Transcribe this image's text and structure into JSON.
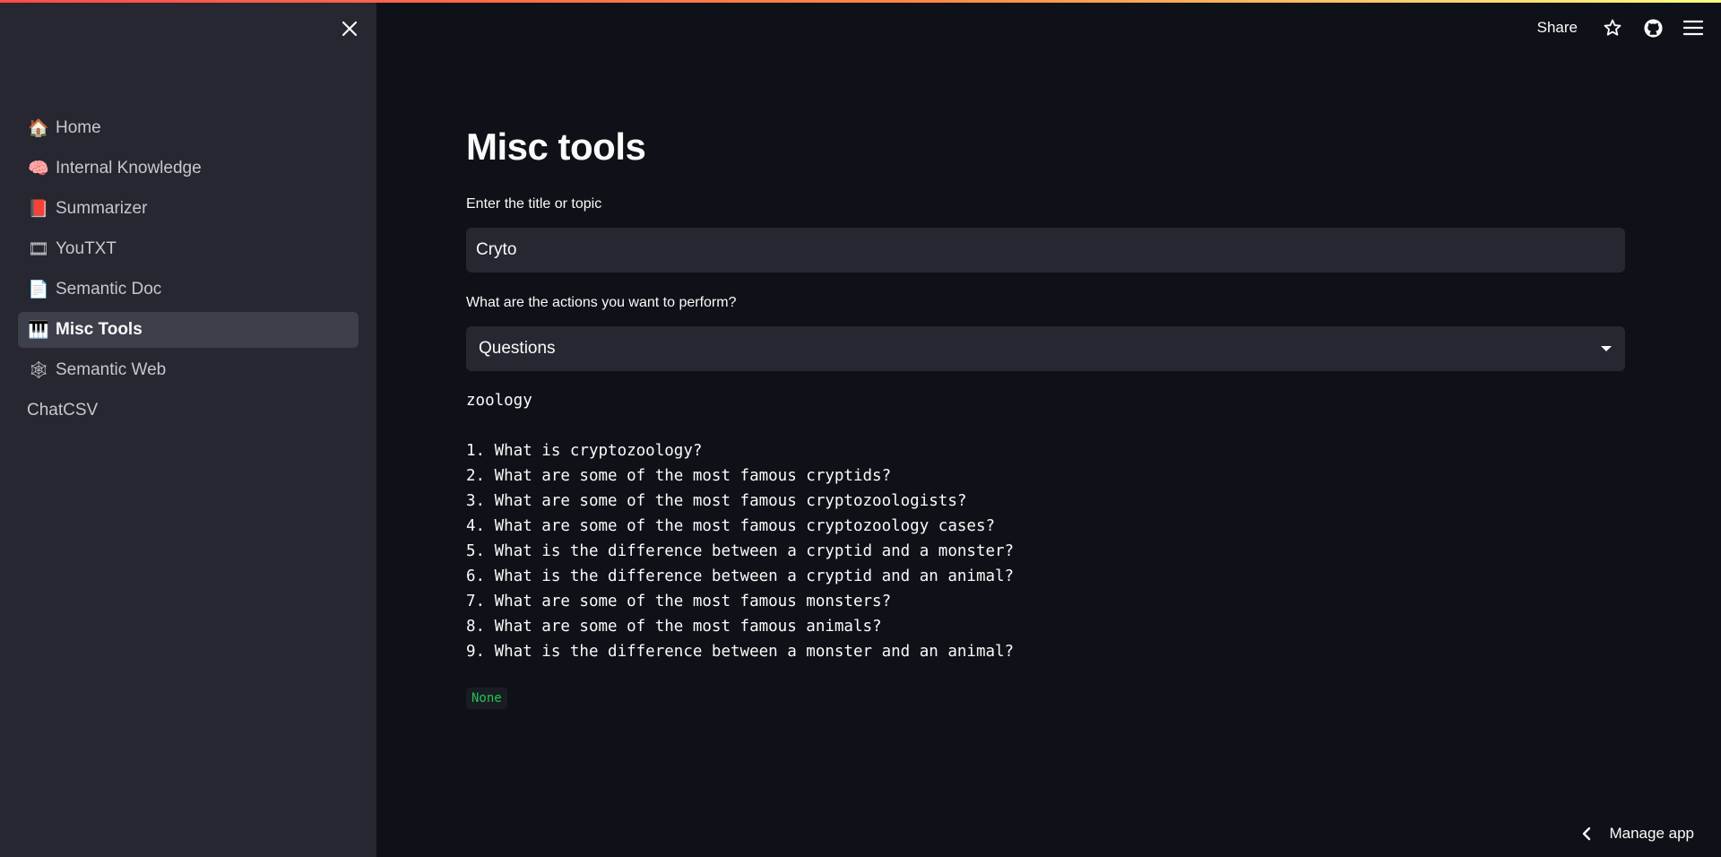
{
  "sidebar": {
    "close_label": "✕",
    "items": [
      {
        "emoji": "🏠",
        "label": "Home",
        "active": false
      },
      {
        "emoji": "🧠",
        "label": "Internal Knowledge",
        "active": false
      },
      {
        "emoji": "📕",
        "label": "Summarizer",
        "active": false
      },
      {
        "emoji": "🎞",
        "label": "YouTXT",
        "active": false
      },
      {
        "emoji": "📄",
        "label": "Semantic Doc",
        "active": false
      },
      {
        "emoji": "🎹",
        "label": "Misc Tools",
        "active": true
      },
      {
        "emoji": "🕸",
        "label": "Semantic Web",
        "active": false
      },
      {
        "emoji": "",
        "label": "ChatCSV",
        "active": false
      }
    ]
  },
  "header": {
    "share_label": "Share",
    "icons": [
      "star-icon",
      "github-icon",
      "hamburger-menu-icon"
    ]
  },
  "main": {
    "title": "Misc tools",
    "topic_label": "Enter the title or topic",
    "topic_value": "Cryto",
    "action_label": "What are the actions you want to perform?",
    "action_value": "Questions",
    "output_text": "zoology\n\n1. What is cryptozoology?\n2. What are some of the most famous cryptids?\n3. What are some of the most famous cryptozoologists?\n4. What are some of the most famous cryptozoology cases?\n5. What is the difference between a cryptid and a monster?\n6. What is the difference between a cryptid and an animal?\n7. What are some of the most famous monsters?\n8. What are some of the most famous animals?\n9. What is the difference between a monster and an animal?",
    "none_badge": "None"
  },
  "footer": {
    "manage_label": "Manage app"
  },
  "colors": {
    "background": "#0e1117",
    "sidebar": "#262730",
    "active_item": "#3d3f4b",
    "badge_text": "#21c354"
  }
}
